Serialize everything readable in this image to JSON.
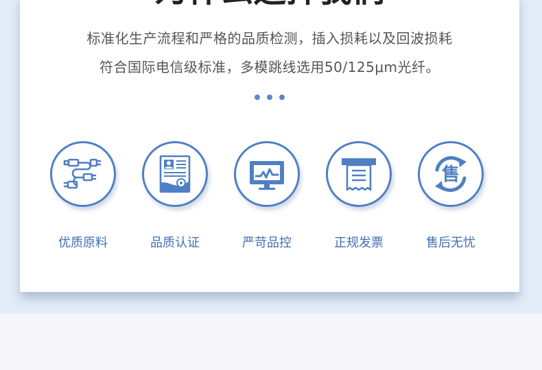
{
  "headline": "为什么选择我们",
  "description": {
    "line1": "标准化生产流程和严格的品质检测，插入损耗以及回波损耗",
    "line2": "符合国际电信级标准，多模跳线选用50/125μm光纤。"
  },
  "accent_color": "#4f7fc4",
  "features": [
    {
      "icon": "cable-connector-icon",
      "label": "优质原料"
    },
    {
      "icon": "certificate-icon",
      "label": "品质认证"
    },
    {
      "icon": "monitor-chart-icon",
      "label": "严苛品控"
    },
    {
      "icon": "receipt-printer-icon",
      "label": "正规发票"
    },
    {
      "icon": "after-sales-cycle-icon",
      "icon_text": "售",
      "label": "售后无忧"
    }
  ]
}
